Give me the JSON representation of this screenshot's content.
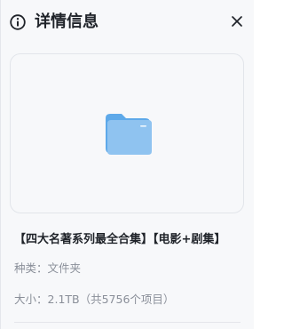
{
  "header": {
    "title": "详情信息",
    "info_icon": "info-circle-icon",
    "close_icon": "close-icon"
  },
  "preview": {
    "icon": "folder-icon"
  },
  "file": {
    "name": "【四大名著系列最全合集】【电影+剧集】",
    "type_label": "种类：",
    "type_value": "文件夹",
    "size_label": "大小：",
    "size_value": "2.1TB（共5756个项目）"
  },
  "colors": {
    "title_text": "#1f2329",
    "meta_text": "#8a8f99",
    "panel_bg": "#f7f8fa",
    "folder_front": "#8fc3f0",
    "folder_back": "#5ea9e9"
  }
}
